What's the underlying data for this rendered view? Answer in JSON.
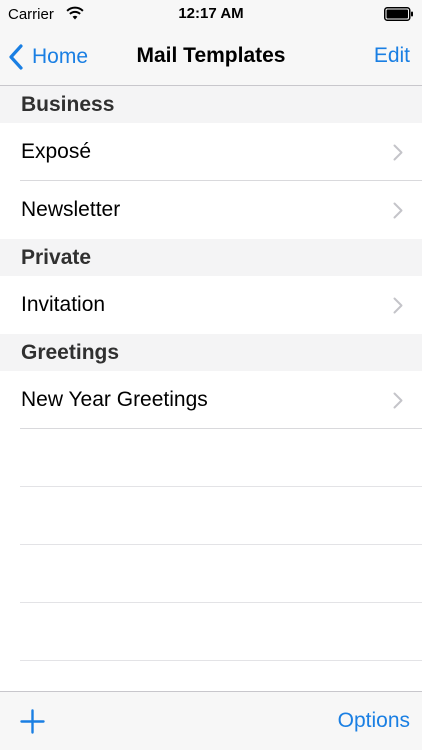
{
  "status_bar": {
    "carrier": "Carrier",
    "time": "12:17 AM",
    "wifi_icon": "wifi-icon",
    "battery_icon": "battery-icon"
  },
  "nav": {
    "back_label": "Home",
    "title": "Mail Templates",
    "edit_label": "Edit",
    "back_icon": "chevron-left-icon"
  },
  "sections": [
    {
      "header": "Business",
      "items": [
        "Exposé",
        "Newsletter"
      ]
    },
    {
      "header": "Private",
      "items": [
        "Invitation"
      ]
    },
    {
      "header": "Greetings",
      "items": [
        "New Year Greetings"
      ]
    }
  ],
  "toolbar": {
    "add_icon": "plus-icon",
    "options_label": "Options"
  },
  "colors": {
    "accent": "#1a7fe3",
    "bar_background": "#f7f7f7",
    "section_background": "#f4f4f5"
  }
}
